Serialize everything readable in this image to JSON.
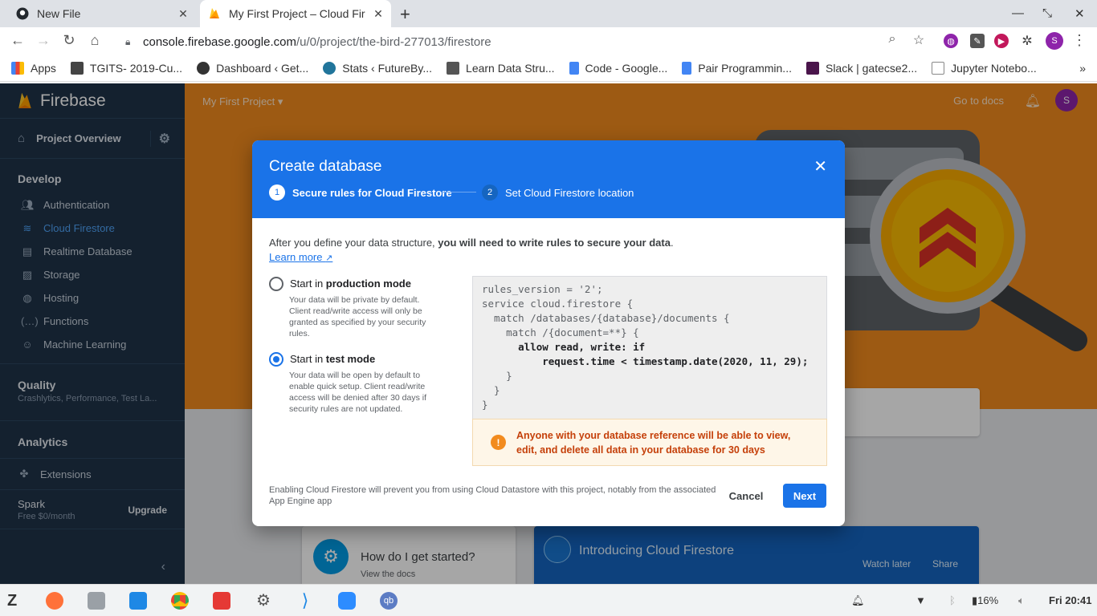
{
  "browser": {
    "tabs": [
      {
        "title": "New File"
      },
      {
        "title": "My First Project – Cloud Fire"
      }
    ],
    "url_domain": "console.firebase.google.com",
    "url_path": "/u/0/project/the-bird-277013/firestore",
    "profile_initial": "S",
    "bookmarks": [
      {
        "label": "Apps",
        "color": "#4285f4"
      },
      {
        "label": "TGITS- 2019-Cu...",
        "color": "#444444"
      },
      {
        "label": "Dashboard ‹ Get...",
        "color": "#333333"
      },
      {
        "label": "Stats ‹ FutureBy...",
        "color": "#21759b"
      },
      {
        "label": "Learn Data Stru...",
        "color": "#555555"
      },
      {
        "label": "Code - Google...",
        "color": "#4285f4"
      },
      {
        "label": "Pair Programmin...",
        "color": "#4285f4"
      },
      {
        "label": "Slack | gatecse2...",
        "color": "#4a154b"
      },
      {
        "label": "Jupyter Notebo...",
        "color": "#888888"
      }
    ]
  },
  "sidebar": {
    "brand": "Firebase",
    "project_overview": "Project Overview",
    "develop_heading": "Develop",
    "develop_items": [
      {
        "label": "Authentication",
        "icon": "people-icon",
        "active": false
      },
      {
        "label": "Cloud Firestore",
        "icon": "firestore-icon",
        "active": true
      },
      {
        "label": "Realtime Database",
        "icon": "database-icon",
        "active": false
      },
      {
        "label": "Storage",
        "icon": "image-icon",
        "active": false
      },
      {
        "label": "Hosting",
        "icon": "globe-icon",
        "active": false
      },
      {
        "label": "Functions",
        "icon": "functions-icon",
        "active": false
      },
      {
        "label": "Machine Learning",
        "icon": "robot-icon",
        "active": false
      }
    ],
    "quality_heading": "Quality",
    "quality_sub": "Crashlytics, Performance, Test La...",
    "analytics_heading": "Analytics",
    "extensions": "Extensions",
    "plan_name": "Spark",
    "plan_price": "Free $0/month",
    "upgrade": "Upgrade"
  },
  "header": {
    "project_name": "My First Project",
    "go_to_docs": "Go to docs",
    "avatar_initial": "S"
  },
  "background_cards": {
    "how_title": "How do I get started?",
    "how_sub": "View the docs",
    "video_title": "Introducing Cloud Firestore",
    "watch_later": "Watch later",
    "share": "Share"
  },
  "dialog": {
    "title": "Create database",
    "step1_num": "1",
    "step1_label": "Secure rules for Cloud Firestore",
    "step2_num": "2",
    "step2_label": "Set Cloud Firestore location",
    "intro_plain": "After you define your data structure, ",
    "intro_bold": "you will need to write rules to secure your data",
    "intro_end": ".",
    "learn_more": "Learn more",
    "prod_prefix": "Start in ",
    "prod_bold": "production mode",
    "prod_desc": "Your data will be private by default. Client read/write access will only be granted as specified by your security rules.",
    "test_prefix": "Start in ",
    "test_bold": "test mode",
    "test_desc": "Your data will be open by default to enable quick setup. Client read/write access will be denied after 30 days if security rules are not updated.",
    "selected_mode": "test",
    "code_lines": [
      "rules_version = '2';",
      "service cloud.firestore {",
      "  match /databases/{database}/documents {",
      "    match /{document=**} {",
      "      allow read, write: if",
      "          request.time < timestamp.date(2020, 11, 29);",
      "    }",
      "  }",
      "}"
    ],
    "warning": "Anyone with your database reference will be able to view, edit, and delete all data in your database for 30 days",
    "footer_note": "Enabling Cloud Firestore will prevent you from using Cloud Datastore with this project, notably from the associated App Engine app",
    "cancel": "Cancel",
    "next": "Next"
  },
  "taskbar": {
    "battery": "16%",
    "clock": "Fri 20:41"
  }
}
